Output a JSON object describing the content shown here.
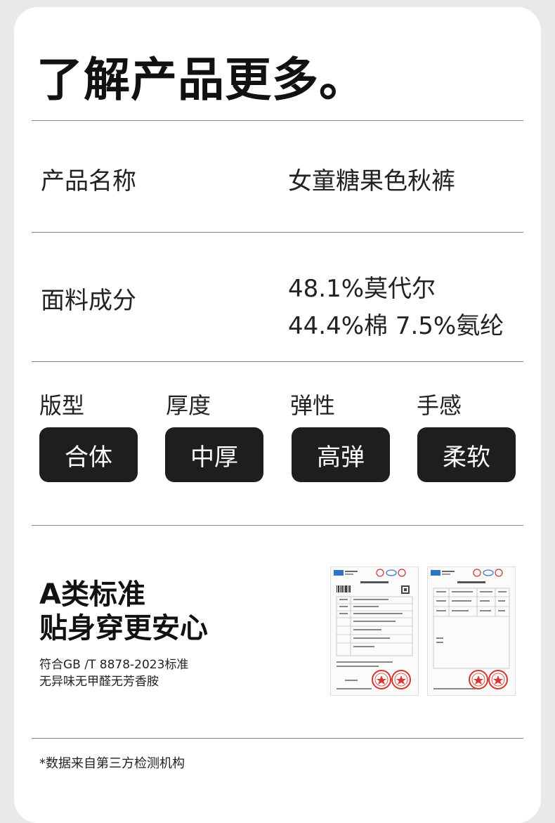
{
  "header": {
    "title": "了解产品更多。"
  },
  "product_name": {
    "label": "产品名称",
    "value": "女童糖果色秋裤"
  },
  "fabric": {
    "label": "面料成分",
    "line1": "48.1%莫代尔",
    "line2": "44.4%棉   7.5%氨纶"
  },
  "attributes": [
    {
      "label": "版型",
      "value": "合体"
    },
    {
      "label": "厚度",
      "value": "中厚"
    },
    {
      "label": "弹性",
      "value": "高弹"
    },
    {
      "label": "手感",
      "value": "柔软"
    }
  ],
  "standard": {
    "title_line1": "A类标准",
    "title_line2": "贴身穿更安心",
    "sub_line1": "符合GB /T 8878-2023标准",
    "sub_line2": "无异味无甲醛无芳香胺"
  },
  "footnote": "*数据来自第三方检测机构",
  "colors": {
    "pill_bg": "#1e1e1e",
    "stamp_red": "#d8352e",
    "logo_blue": "#2d74c4"
  }
}
